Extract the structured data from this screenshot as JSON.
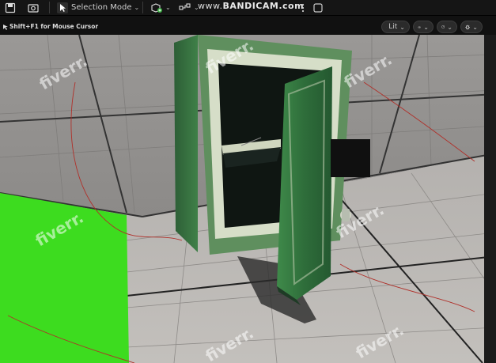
{
  "toolbar": {
    "selection_mode_label": "Selection Mode",
    "recording_watermark": {
      "prefix": "www.",
      "brand": "BANDICAM",
      "suffix": ".com"
    }
  },
  "viewport_header": {
    "hint": "Shift+F1 for Mouse Cursor",
    "lit_label": "Lit"
  },
  "watermarks": {
    "fiverr_text": "fiverr."
  },
  "colors": {
    "toolbar_bg": "#151515",
    "floor_tile": "#bab6b2",
    "wall_tile": "#9c9a98",
    "green_plane": "#3ddc1f",
    "safe_green": "#2f6f3c"
  }
}
